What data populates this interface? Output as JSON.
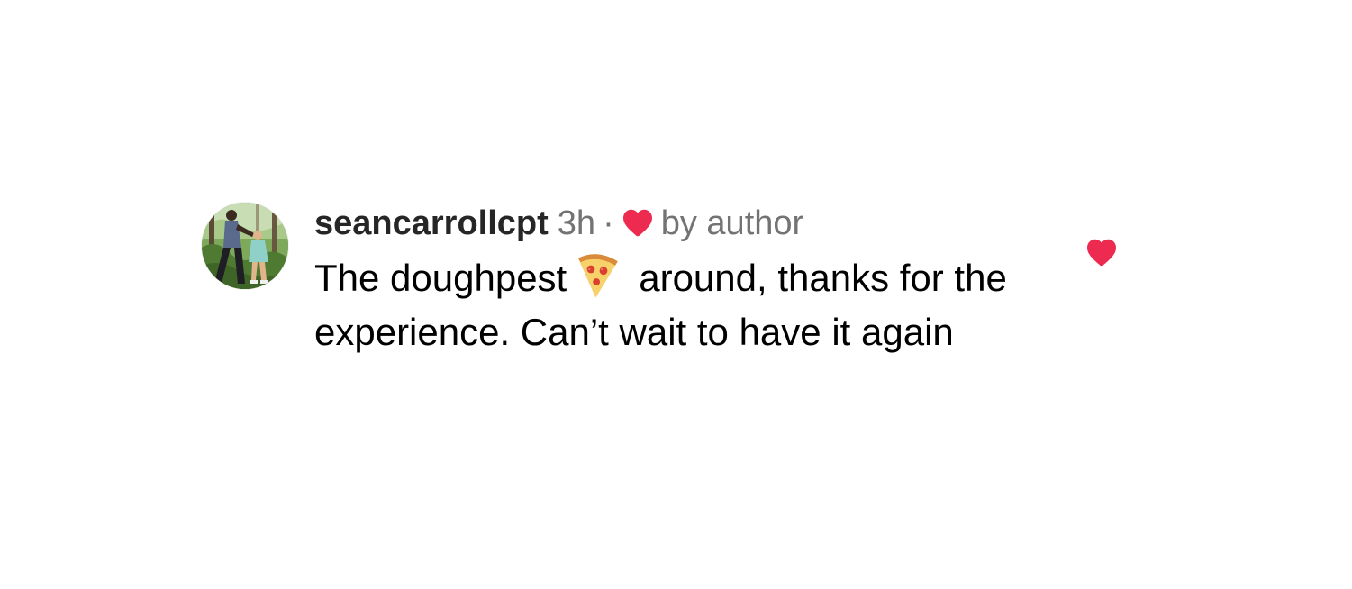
{
  "comment": {
    "username": "seancarrollcpt",
    "time": "3h",
    "separator": "·",
    "liked_by_author_label": "by author",
    "text_before_emoji": "The doughpest",
    "emoji": "pizza-emoji",
    "text_after_emoji": "around, thanks for the experience.  Can’t wait to have it again",
    "liked": true
  },
  "icons": {
    "author_heart": "heart-filled-icon",
    "like_button": "heart-filled-icon",
    "avatar": "user-avatar"
  },
  "colors": {
    "heart": "#ed2a4f",
    "username": "#262626",
    "secondary_text": "#737373",
    "body_text": "#000000",
    "background": "#ffffff"
  }
}
